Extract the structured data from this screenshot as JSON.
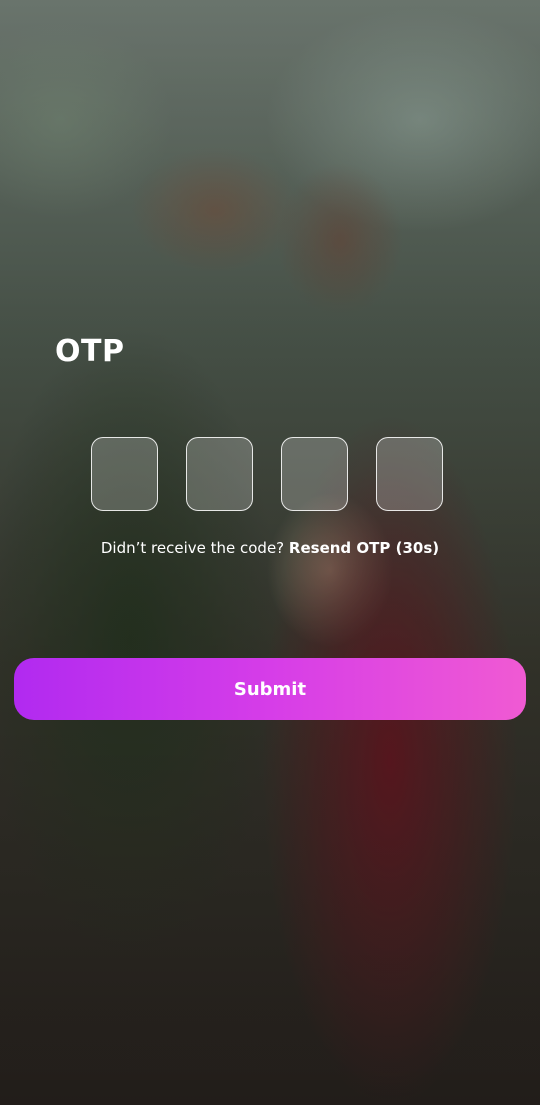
{
  "screen": {
    "title": "OTP"
  },
  "otp": {
    "digits": [
      "",
      "",
      "",
      ""
    ]
  },
  "resend": {
    "prompt": "Didn’t receive the code?",
    "link_label": "Resend OTP (30s)"
  },
  "submit": {
    "label": "Submit"
  },
  "colors": {
    "submit_gradient_start": "#b12af0",
    "submit_gradient_end": "#f05ad3",
    "text": "#ffffff"
  }
}
